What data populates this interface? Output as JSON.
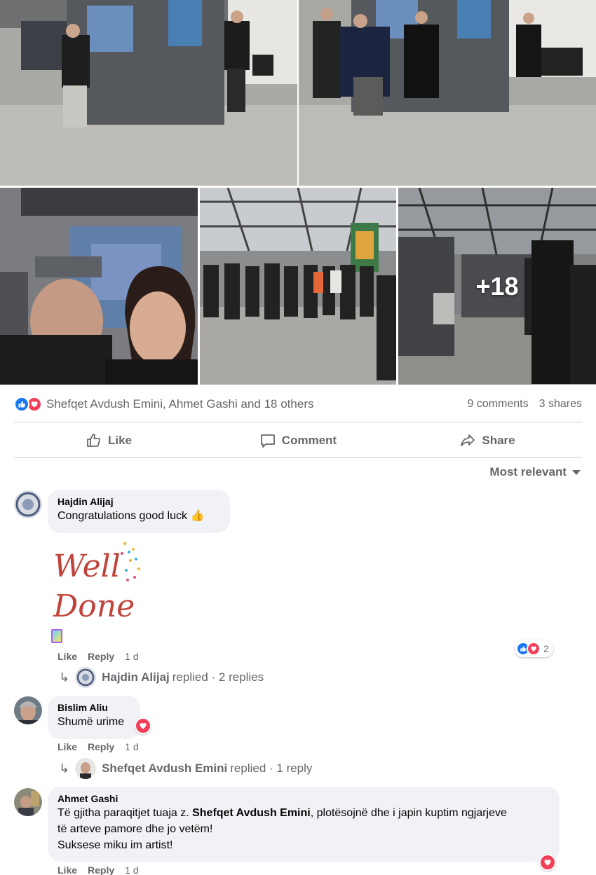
{
  "post": {
    "photos": [
      {
        "alt": "man-in-front-of-paintings"
      },
      {
        "alt": "group-in-front-of-paintings"
      },
      {
        "alt": "selfie-couple"
      },
      {
        "alt": "group-in-hall"
      },
      {
        "alt": "exhibition-hall",
        "more_label": "+18"
      }
    ]
  },
  "reactions": {
    "names": "Shefqet Avdush Emini, Ahmet Gashi and 18 others",
    "comments": "9 comments",
    "shares": "3 shares"
  },
  "actions": {
    "like": "Like",
    "comment": "Comment",
    "share": "Share"
  },
  "sort": {
    "label": "Most relevant"
  },
  "comments": [
    {
      "author": "Hajdin Alijaj",
      "text": "Congratulations good luck",
      "sticker": "Well Done",
      "like": "Like",
      "reply": "Reply",
      "time": "1 d",
      "reaction_count": "2",
      "replies_author": "Hajdin Alijaj",
      "replies_text": "replied · 2 replies"
    },
    {
      "author": "Bislim Aliu",
      "text": "Shumë urime",
      "like": "Like",
      "reply": "Reply",
      "time": "1 d",
      "replies_author": "Shefqet Avdush Emini",
      "replies_text": "replied · 1 reply"
    },
    {
      "author": "Ahmet Gashi",
      "text_part1": "Të gjitha paraqitjet tuaja z. ",
      "text_bold": "Shefqet Avdush Emini",
      "text_part2": ", plotësojnë dhe i japin kuptim ngjarjeve",
      "text_line2": "të arteve pamore dhe jo vetëm!",
      "text_line3": "Suksese miku im artist!",
      "like": "Like",
      "reply": "Reply",
      "time": "1 d"
    }
  ],
  "colors": {
    "like_blue": "#1877f2",
    "love_red": "#f33e58",
    "meta_gray": "#65676b",
    "bubble_bg": "#f0f2f5"
  }
}
